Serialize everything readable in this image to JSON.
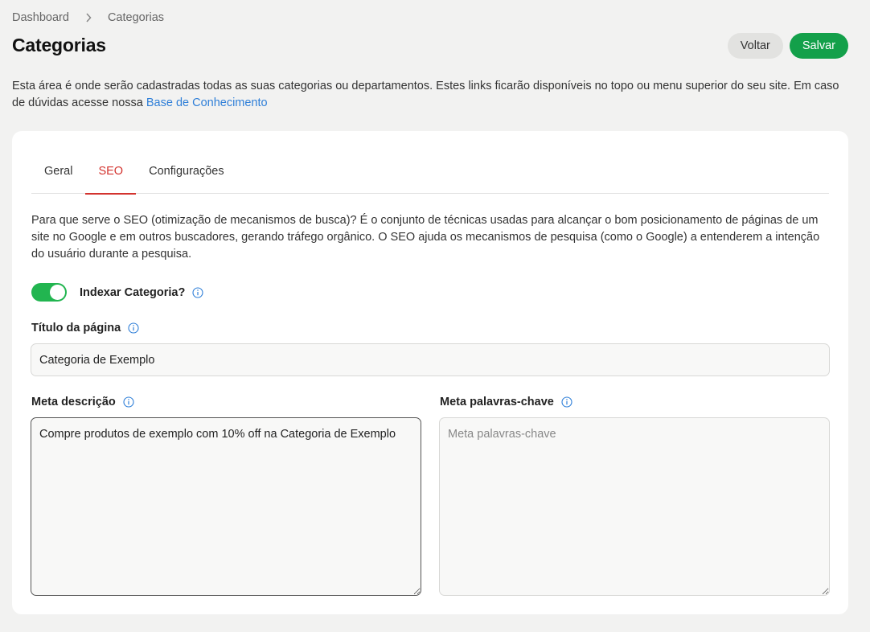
{
  "breadcrumb": {
    "items": [
      "Dashboard",
      "Categorias"
    ]
  },
  "header": {
    "title": "Categorias",
    "back_label": "Voltar",
    "save_label": "Salvar"
  },
  "intro": {
    "text": "Esta área é onde serão cadastradas todas as suas categorias ou departamentos. Estes links ficarão disponíveis no topo ou menu superior do seu site. Em caso de dúvidas acesse nossa ",
    "link": "Base de Conhecimento"
  },
  "tabs": [
    {
      "label": "Geral",
      "active": false
    },
    {
      "label": "SEO",
      "active": true
    },
    {
      "label": "Configurações",
      "active": false
    }
  ],
  "seo": {
    "description": "Para que serve o SEO (otimização de mecanismos de busca)? É o conjunto de técnicas usadas para alcançar o bom posicionamento de páginas de um site no Google e em outros buscadores, gerando tráfego orgânico. O SEO ajuda os mecanismos de pesquisa (como o Google) a entenderem a intenção do usuário durante a pesquisa.",
    "index_label": "Indexar Categoria?",
    "index_enabled": true,
    "page_title_label": "Título da página",
    "page_title_value": "Categoria de Exemplo",
    "meta_description_label": "Meta descrição",
    "meta_description_value": "Compre produtos de exemplo com 10% off na Categoria de Exemplo",
    "meta_keywords_label": "Meta palavras-chave",
    "meta_keywords_placeholder": "Meta palavras-chave",
    "meta_keywords_value": ""
  },
  "colors": {
    "accent_tab": "#d3332e",
    "save_button": "#13a04a",
    "toggle_on": "#22b550",
    "link": "#2f7fd8",
    "info_icon": "#2f7fd8"
  },
  "icons": {
    "breadcrumb_separator": "chevron-right-icon",
    "info": "info-icon"
  }
}
